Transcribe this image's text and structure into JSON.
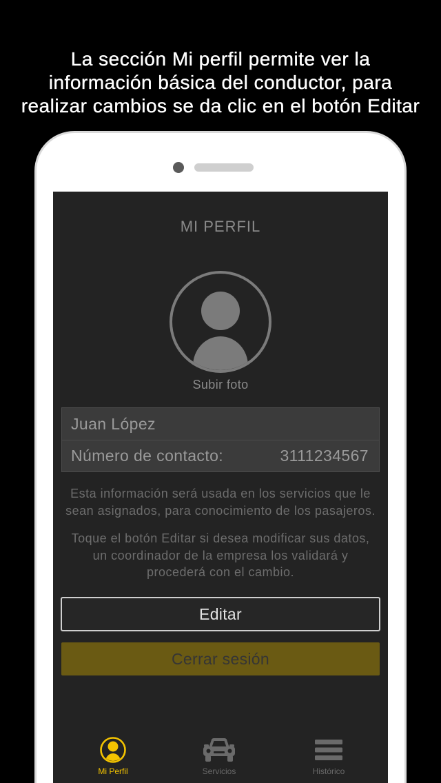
{
  "caption": {
    "lines": [
      "La sección Mi perfil permite ver la",
      "información básica del conductor, para",
      "realizar cambios se da clic en el botón Editar"
    ]
  },
  "phone": {
    "title": "MI PERFIL",
    "avatar": {
      "icon": "user-avatar-icon",
      "upload_label": "Subir foto"
    },
    "profile": {
      "name": "Juan López",
      "contact_label": "Número de contacto:",
      "contact_value": "3111234567"
    },
    "info_paragraphs": [
      {
        "lines": [
          "Esta información será usada en los servicios que le",
          "sean asignados, para conocimiento de los pasajeros."
        ]
      },
      {
        "lines": [
          "Toque el botón Editar si desea modificar sus datos,",
          "un coordinador de la empresa los validará y",
          "procederá con el cambio."
        ]
      }
    ],
    "buttons": {
      "edit_label": "Editar",
      "logout_label": "Cerrar sesión"
    },
    "tabs": [
      {
        "label": "Mi Perfil",
        "icon": "user-circle-icon",
        "active": true
      },
      {
        "label": "Servicios",
        "icon": "car-icon",
        "active": false
      },
      {
        "label": "Histórico",
        "icon": "menu-icon",
        "active": false
      }
    ]
  },
  "colors": {
    "page_background": "#000000",
    "phone_frame": "#ffffff",
    "screen_background": "#232323",
    "accent": "#f3c300",
    "logout_button": "#6a5a13",
    "muted_text": "#8a8a8a",
    "inactive_tab": "#6a6a6a"
  }
}
